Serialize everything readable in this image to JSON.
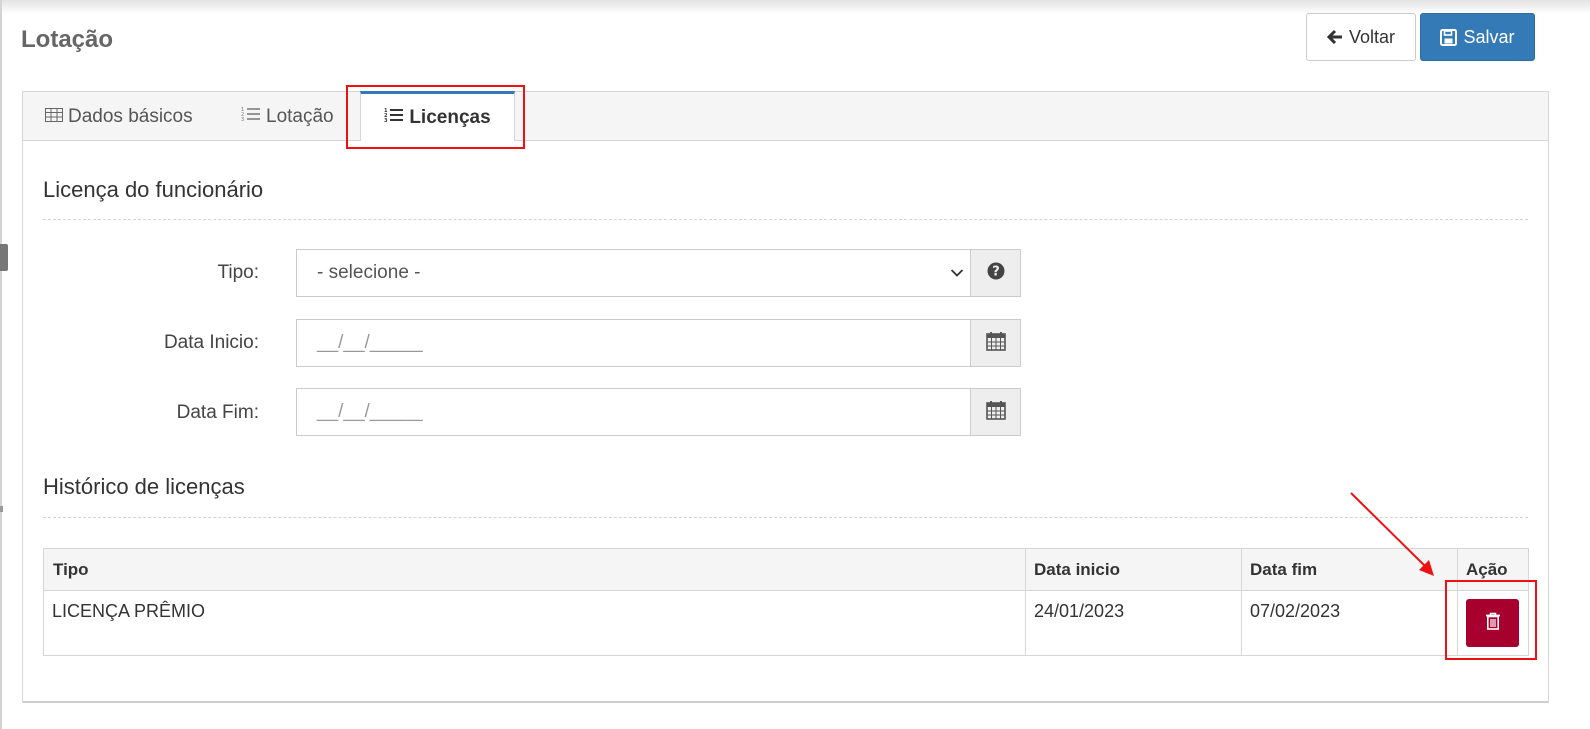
{
  "page": {
    "title": "Lotação"
  },
  "actions": {
    "back_label": "Voltar",
    "save_label": "Salvar"
  },
  "tabs": [
    {
      "label": "Dados básicos",
      "icon": "table-icon",
      "active": false
    },
    {
      "label": "Lotação",
      "icon": "list-ol-icon",
      "active": false
    },
    {
      "label": "Licenças",
      "icon": "list-ol-icon",
      "active": true
    }
  ],
  "license_form": {
    "title": "Licença do funcionário",
    "tipo_label": "Tipo:",
    "tipo_value": "- selecione -",
    "data_inicio_label": "Data Inicio:",
    "data_inicio_value": "__/__/_____",
    "data_fim_label": "Data Fim:",
    "data_fim_value": "__/__/_____"
  },
  "history": {
    "title": "Histórico de licenças",
    "columns": [
      "Tipo",
      "Data inicio",
      "Data fim",
      "Ação"
    ],
    "rows": [
      {
        "tipo": "LICENÇA PRÊMIO",
        "data_inicio": "24/01/2023",
        "data_fim": "07/02/2023"
      }
    ]
  },
  "colors": {
    "primary": "#337ab7",
    "danger": "#a8002e",
    "annotation": "#ee1111"
  }
}
